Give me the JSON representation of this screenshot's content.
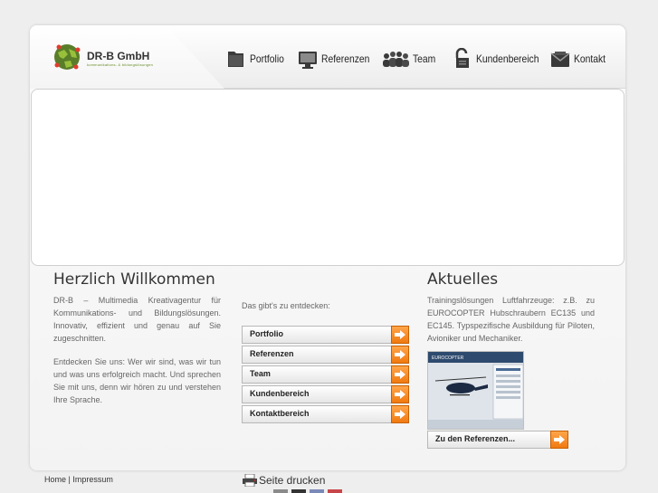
{
  "header": {
    "company": "DR-B GmbH",
    "tagline": "kommunikations- & bildungslösungen"
  },
  "nav": [
    {
      "label": "Portfolio",
      "icon": "folder-icon"
    },
    {
      "label": "Referenzen",
      "icon": "monitor-icon"
    },
    {
      "label": "Team",
      "icon": "people-icon"
    },
    {
      "label": "Kundenbereich",
      "icon": "lock-icon"
    },
    {
      "label": "Kontakt",
      "icon": "envelope-icon"
    }
  ],
  "welcome": {
    "title": "Herzlich Willkommen",
    "paragraph1": "DR-B – Multimedia Kreativagentur für Kommunikations- und Bildungslösungen. Innovativ, effizient und genau auf Sie zugeschnitten.",
    "paragraph2": "Entdecken Sie uns: Wer wir sind, was wir tun und was uns erfolgreich macht. Und sprechen Sie mit uns, denn wir hören zu und verstehen Ihre Sprache."
  },
  "discover": {
    "label": "Das gibt's zu entdecken:",
    "buttons": [
      "Portfolio",
      "Referenzen",
      "Team",
      "Kundenbereich",
      "Kontaktbereich"
    ]
  },
  "news": {
    "title": "Aktuelles",
    "text": "Trainingslösungen Luftfahrzeuge: z.B. zu EUROCOPTER Hubschraubern EC135 und EC145. Typspezifische Ausbildung für Piloten, Avioniker und Mechaniker.",
    "image_caption": "EUROCOPTER",
    "button": "Zu den Referenzen..."
  },
  "footer": {
    "home": "Home",
    "separator": "|",
    "impressum": "Impressum",
    "print": "Seite drucken"
  },
  "colors": {
    "accent": "#f07a10",
    "text": "#666666",
    "heading": "#333333"
  }
}
